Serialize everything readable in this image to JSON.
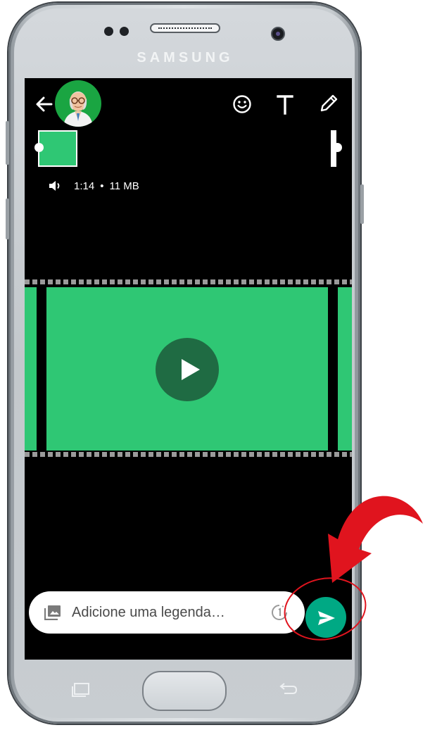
{
  "device": {
    "brand": "SAMSUNG"
  },
  "header": {
    "icons": [
      "back-arrow-icon",
      "avatar",
      "emoji-icon",
      "text-icon",
      "pencil-icon"
    ]
  },
  "video": {
    "duration": "1:14",
    "separator": "•",
    "size": "11 MB"
  },
  "caption": {
    "placeholder": "Adicione uma legenda…"
  },
  "colors": {
    "accent": "#00a984",
    "video_green": "#2fc774",
    "play_dark": "#1f6b43",
    "annotation_red": "#e0141e"
  }
}
